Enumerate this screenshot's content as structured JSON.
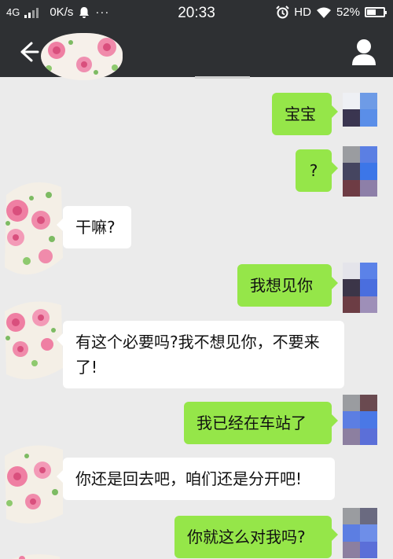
{
  "status_bar": {
    "network": "4G",
    "speed": "0K/s",
    "more": "···",
    "time": "20:33",
    "hd": "HD",
    "battery": "52%",
    "battery_level": 0.52
  },
  "title_bar": {
    "back_icon": "arrow-left-icon",
    "profile_icon": "person-icon"
  },
  "messages": [
    {
      "side": "out",
      "text": "宝宝"
    },
    {
      "side": "out",
      "text": "?"
    },
    {
      "side": "in",
      "text": "干嘛?"
    },
    {
      "side": "out",
      "text": "我想见你"
    },
    {
      "side": "in",
      "text": "有这个必要吗?我不想见你，不要来了!"
    },
    {
      "side": "out",
      "text": "我已经在车站了"
    },
    {
      "side": "in",
      "text": "你还是回去吧，咱们还是分开吧!"
    },
    {
      "side": "out",
      "text": "你就这么对我吗?"
    }
  ],
  "colors": {
    "bar": "#2e3033",
    "bubble_out": "#95e649",
    "bubble_in": "#ffffff",
    "chat_bg": "#ebebeb"
  }
}
